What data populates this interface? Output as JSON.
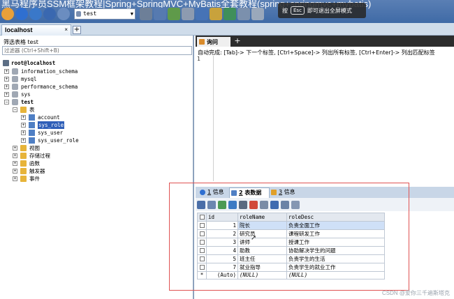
{
  "window": {
    "title": "黑马程序员SSM框架教程|Spring+SpringMVC+MyBatis全套教程(spring+springmvc+mybatis)"
  },
  "toolbar": {
    "database_select": "test"
  },
  "fullscreen_hint": {
    "prefix": "按",
    "key": "Esc",
    "suffix": "即可退出全屏模式"
  },
  "connection_tab": {
    "label": "localhost",
    "close": "×",
    "add": "+"
  },
  "left_panel": {
    "filter_label": "筛选表格 test",
    "filter_placeholder": "过滤器 (Ctrl+Shift+B)",
    "tree": {
      "root": "root@localhost",
      "databases": [
        "information_schema",
        "mysql",
        "performance_schema",
        "sys"
      ],
      "open_db": "test",
      "tables_folder": "表",
      "tables": [
        "account",
        "sys_role",
        "sys_user",
        "sys_user_role"
      ],
      "selected_table": "sys_role",
      "other_folders": [
        "视图",
        "存储过程",
        "函数",
        "触发器",
        "事件"
      ]
    }
  },
  "query_editor": {
    "tab_label": "询问",
    "add": "+",
    "autocomplete_hint": "自动完成: [Tab]-> 下一个标签, [Ctrl+Space]-> 列出所有标签, [Ctrl+Enter]-> 列出匹配标签",
    "line_number": "1"
  },
  "result_tabs": [
    {
      "num": "1",
      "label": "信息"
    },
    {
      "num": "2",
      "label": "表数据"
    },
    {
      "num": "3",
      "label": "信息"
    }
  ],
  "grid": {
    "columns": [
      "id",
      "roleName",
      "roleDesc"
    ],
    "rows": [
      {
        "id": "1",
        "roleName": "院长",
        "roleDesc": "负责全面工作"
      },
      {
        "id": "2",
        "roleName": "研究员",
        "roleDesc": "课程研发工作"
      },
      {
        "id": "3",
        "roleName": "讲师",
        "roleDesc": "授课工作"
      },
      {
        "id": "4",
        "roleName": "助教",
        "roleDesc": "协助解决学生的问题"
      },
      {
        "id": "5",
        "roleName": "班主任",
        "roleDesc": "负责学生的生活"
      },
      {
        "id": "7",
        "roleName": "就业指导",
        "roleDesc": "负责学生的就业工作"
      }
    ],
    "new_row": {
      "marker": "*",
      "id": "(Auto)",
      "roleName": "(NULL)",
      "roleDesc": "(NULL)"
    }
  },
  "watermark": "CSDN @爱你三千遍斯塔克",
  "colors": {
    "title_bar": "#4a72ad",
    "selection": "#2f5fb8",
    "annotation": "#e05252"
  }
}
